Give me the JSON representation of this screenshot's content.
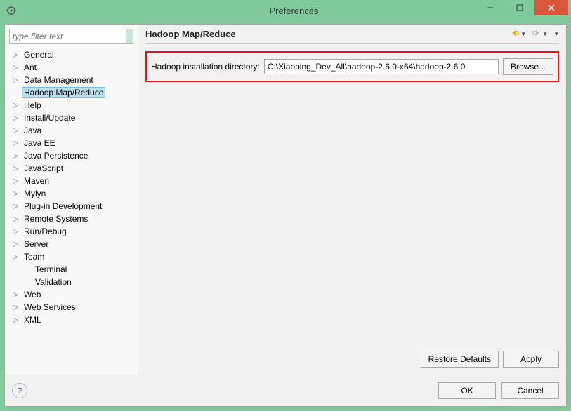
{
  "window": {
    "title": "Preferences"
  },
  "sidebar": {
    "filter_placeholder": "type filter text",
    "items": [
      {
        "label": "General",
        "expandable": true
      },
      {
        "label": "Ant",
        "expandable": true
      },
      {
        "label": "Data Management",
        "expandable": true
      },
      {
        "label": "Hadoop Map/Reduce",
        "expandable": false,
        "selected": true
      },
      {
        "label": "Help",
        "expandable": true
      },
      {
        "label": "Install/Update",
        "expandable": true
      },
      {
        "label": "Java",
        "expandable": true
      },
      {
        "label": "Java EE",
        "expandable": true
      },
      {
        "label": "Java Persistence",
        "expandable": true
      },
      {
        "label": "JavaScript",
        "expandable": true
      },
      {
        "label": "Maven",
        "expandable": true
      },
      {
        "label": "Mylyn",
        "expandable": true
      },
      {
        "label": "Plug-in Development",
        "expandable": true
      },
      {
        "label": "Remote Systems",
        "expandable": true
      },
      {
        "label": "Run/Debug",
        "expandable": true
      },
      {
        "label": "Server",
        "expandable": true
      },
      {
        "label": "Team",
        "expandable": true
      },
      {
        "label": "Terminal",
        "expandable": false,
        "indent": true
      },
      {
        "label": "Validation",
        "expandable": false,
        "indent": true
      },
      {
        "label": "Web",
        "expandable": true
      },
      {
        "label": "Web Services",
        "expandable": true
      },
      {
        "label": "XML",
        "expandable": true
      }
    ]
  },
  "panel": {
    "title": "Hadoop Map/Reduce",
    "install_dir_label": "Hadoop installation directory:",
    "install_dir_value": "C:\\Xiaoping_Dev_All\\hadoop-2.6.0-x64\\hadoop-2.6.0",
    "browse_label": "Browse...",
    "restore_label": "Restore Defaults",
    "apply_label": "Apply"
  },
  "footer": {
    "ok_label": "OK",
    "cancel_label": "Cancel"
  }
}
